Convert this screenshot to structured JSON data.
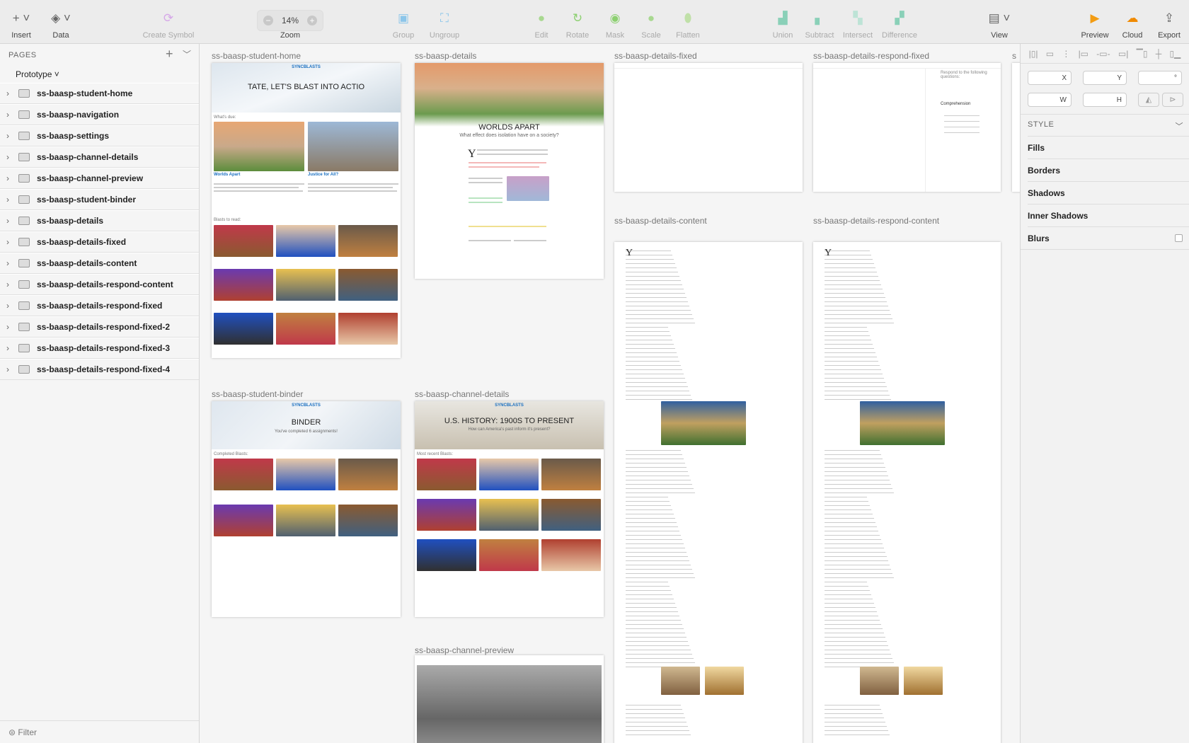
{
  "toolbar": {
    "insert": "Insert",
    "data": "Data",
    "create_symbol": "Create Symbol",
    "zoom_value": "14%",
    "zoom": "Zoom",
    "group": "Group",
    "ungroup": "Ungroup",
    "edit": "Edit",
    "rotate": "Rotate",
    "mask": "Mask",
    "scale": "Scale",
    "flatten": "Flatten",
    "union": "Union",
    "subtract": "Subtract",
    "intersect": "Intersect",
    "difference": "Difference",
    "view": "View",
    "preview": "Preview",
    "cloud": "Cloud",
    "export": "Export"
  },
  "sidebar": {
    "header": "PAGES",
    "current_page": "Prototype",
    "filter": "Filter",
    "artboards": [
      "ss-baasp-student-home",
      "ss-baasp-navigation",
      "ss-baasp-settings",
      "ss-baasp-channel-details",
      "ss-baasp-channel-preview",
      "ss-baasp-student-binder",
      "ss-baasp-details",
      "ss-baasp-details-fixed",
      "ss-baasp-details-content",
      "ss-baasp-details-respond-content",
      "ss-baasp-details-respond-fixed",
      "ss-baasp-details-respond-fixed-2",
      "ss-baasp-details-respond-fixed-3",
      "ss-baasp-details-respond-fixed-4"
    ]
  },
  "canvas": {
    "student_home": {
      "label": "ss-baasp-student-home",
      "logo": "SYNCBLASTS",
      "title": "TATE, LET'S BLAST INTO ACTIO",
      "due": "What's due:",
      "card1": "Worlds Apart",
      "card2": "Justice for All?",
      "blasts": "Blasts to read:"
    },
    "details": {
      "label": "ss-baasp-details",
      "title": "WORLDS APART",
      "subtitle": "What effect does isolation have on a society?"
    },
    "details_fixed": {
      "label": "ss-baasp-details-fixed"
    },
    "respond_fixed": {
      "label": "ss-baasp-details-respond-fixed",
      "respond": "Respond to the following questions:",
      "comprehension": "Comprehension"
    },
    "partial_label": "s",
    "details_content": {
      "label": "ss-baasp-details-content"
    },
    "respond_content": {
      "label": "ss-baasp-details-respond-content"
    },
    "binder": {
      "label": "ss-baasp-student-binder",
      "logo": "SYNCBLASTS",
      "title": "BINDER",
      "subtitle": "You've completed 6 assignments!",
      "completed": "Completed Blasts:"
    },
    "channel_details": {
      "label": "ss-baasp-channel-details",
      "logo": "SYNCBLASTS",
      "title": "U.S. HISTORY: 1900S TO PRESENT",
      "subtitle": "How can America's past inform it's present?",
      "recent": "Most recent Blasts:"
    },
    "channel_preview": {
      "label": "ss-baasp-channel-preview"
    }
  },
  "inspector": {
    "x": "X",
    "y": "Y",
    "rotation": "°",
    "w": "W",
    "h": "H",
    "style": "STYLE",
    "fills": "Fills",
    "borders": "Borders",
    "shadows": "Shadows",
    "inner_shadows": "Inner Shadows",
    "blurs": "Blurs"
  },
  "colors": {
    "accent": "#1a6fc0",
    "toolbar_bg": "#ececec",
    "canvas_bg": "#f5f5f5"
  }
}
